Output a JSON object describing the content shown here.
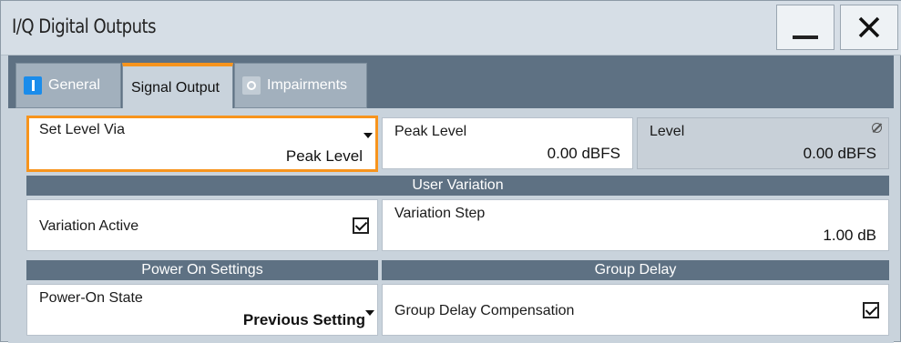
{
  "window": {
    "title": "I/Q Digital Outputs",
    "minimize_label": "—",
    "close_label": "✕"
  },
  "tabs": [
    {
      "label": "General",
      "indicator": "on",
      "active": false
    },
    {
      "label": "Signal Output",
      "active": true
    },
    {
      "label": "Impairments",
      "indicator": "off",
      "active": false
    }
  ],
  "fields": {
    "set_level_via": {
      "label": "Set Level Via",
      "value": "Peak Level"
    },
    "peak_level": {
      "label": "Peak Level",
      "value": "0.00 dBFS"
    },
    "level": {
      "label": "Level",
      "value": "0.00 dBFS"
    },
    "variation_active": {
      "label": "Variation Active",
      "checked": true
    },
    "variation_step": {
      "label": "Variation Step",
      "value": "1.00 dB"
    },
    "power_on_state": {
      "label": "Power-On State",
      "value": "Previous Setting"
    },
    "group_delay_compensation": {
      "label": "Group Delay Compensation",
      "checked": true
    }
  },
  "sections": {
    "user_variation": "User Variation",
    "power_on_settings": "Power On Settings",
    "group_delay": "Group Delay"
  },
  "colors": {
    "accent_orange": "#f7941d",
    "header_blue_gray": "#5e7183",
    "indicator_blue": "#1a8ceb"
  }
}
